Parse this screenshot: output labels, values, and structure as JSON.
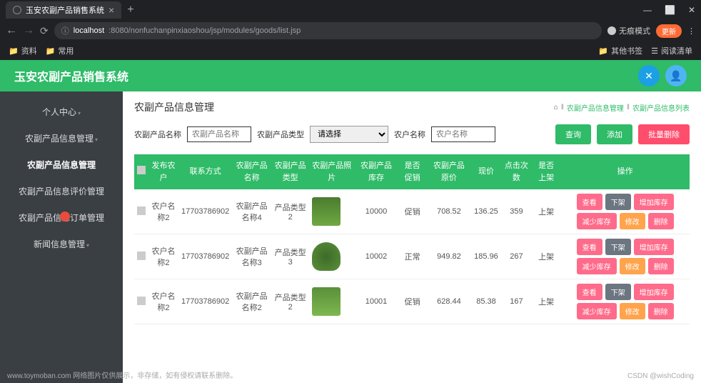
{
  "browser": {
    "tab_title": "玉安农副产品销售系统",
    "url_host": "localhost",
    "url_path": ":8080/nonfuchanpinxiaoshou/jsp/modules/goods/list.jsp",
    "incognito": "无痕模式",
    "update": "更新",
    "bookmarks": {
      "docs": "资料",
      "common": "常用",
      "other": "其他书签",
      "reading": "阅读清单"
    }
  },
  "header": {
    "title": "玉安农副产品销售系统"
  },
  "sidebar": {
    "items": [
      {
        "label": "个人中心"
      },
      {
        "label": "农副产品信息管理"
      },
      {
        "label": "农副产品信息管理"
      },
      {
        "label": "农副产品信息评价管理"
      },
      {
        "label": "农副产品信息订单管理"
      },
      {
        "label": "新闻信息管理"
      }
    ]
  },
  "page": {
    "title": "农副产品信息管理",
    "bc_home": "⌂",
    "bc_sep": "‖",
    "bc1": "农副产品信息管理",
    "bc2": "农副产品信息列表"
  },
  "filter": {
    "name_label": "农副产品名称",
    "name_ph": "农副产品名称",
    "type_label": "农副产品类型",
    "type_ph": "请选择",
    "farmer_label": "农户名称",
    "farmer_ph": "农户名称",
    "query": "查询",
    "add": "添加",
    "batch_del": "批量删除"
  },
  "table": {
    "headers": {
      "farmer": "发布农\n户",
      "contact": "联系方式",
      "name": "农副产品\n名称",
      "type": "农副产品\n类型",
      "image": "农副产品照片",
      "stock": "农副产品\n库存",
      "promo": "是否\n促销",
      "orig": "农副产品\n原价",
      "now": "现价",
      "clicks": "点击次\n数",
      "shelf": "是否\n上架",
      "ops": "操作"
    },
    "rows": [
      {
        "farmer": "农户名称2",
        "contact": "17703786902",
        "name": "农副产品名称4",
        "type": "产品类型2",
        "stock": "10000",
        "promo": "促销",
        "orig": "708.52",
        "now": "136.25",
        "clicks": "359",
        "shelf": "上架"
      },
      {
        "farmer": "农户名称2",
        "contact": "17703786902",
        "name": "农副产品名称3",
        "type": "产品类型3",
        "stock": "10002",
        "promo": "正常",
        "orig": "949.82",
        "now": "185.96",
        "clicks": "267",
        "shelf": "上架"
      },
      {
        "farmer": "农户名称2",
        "contact": "17703786902",
        "name": "农副产品名称2",
        "type": "产品类型2",
        "stock": "10001",
        "promo": "促销",
        "orig": "628.44",
        "now": "85.38",
        "clicks": "167",
        "shelf": "上架"
      }
    ],
    "ops": {
      "view": "查看",
      "off": "下架",
      "addstock": "增加库存",
      "reduce": "减少库存",
      "edit": "修改",
      "delete": "删除"
    }
  },
  "watermark": {
    "left": "www.toymoban.com 网络图片仅供展示，非存储，如有侵权请联系删除。",
    "right": "CSDN @wishCoding"
  }
}
